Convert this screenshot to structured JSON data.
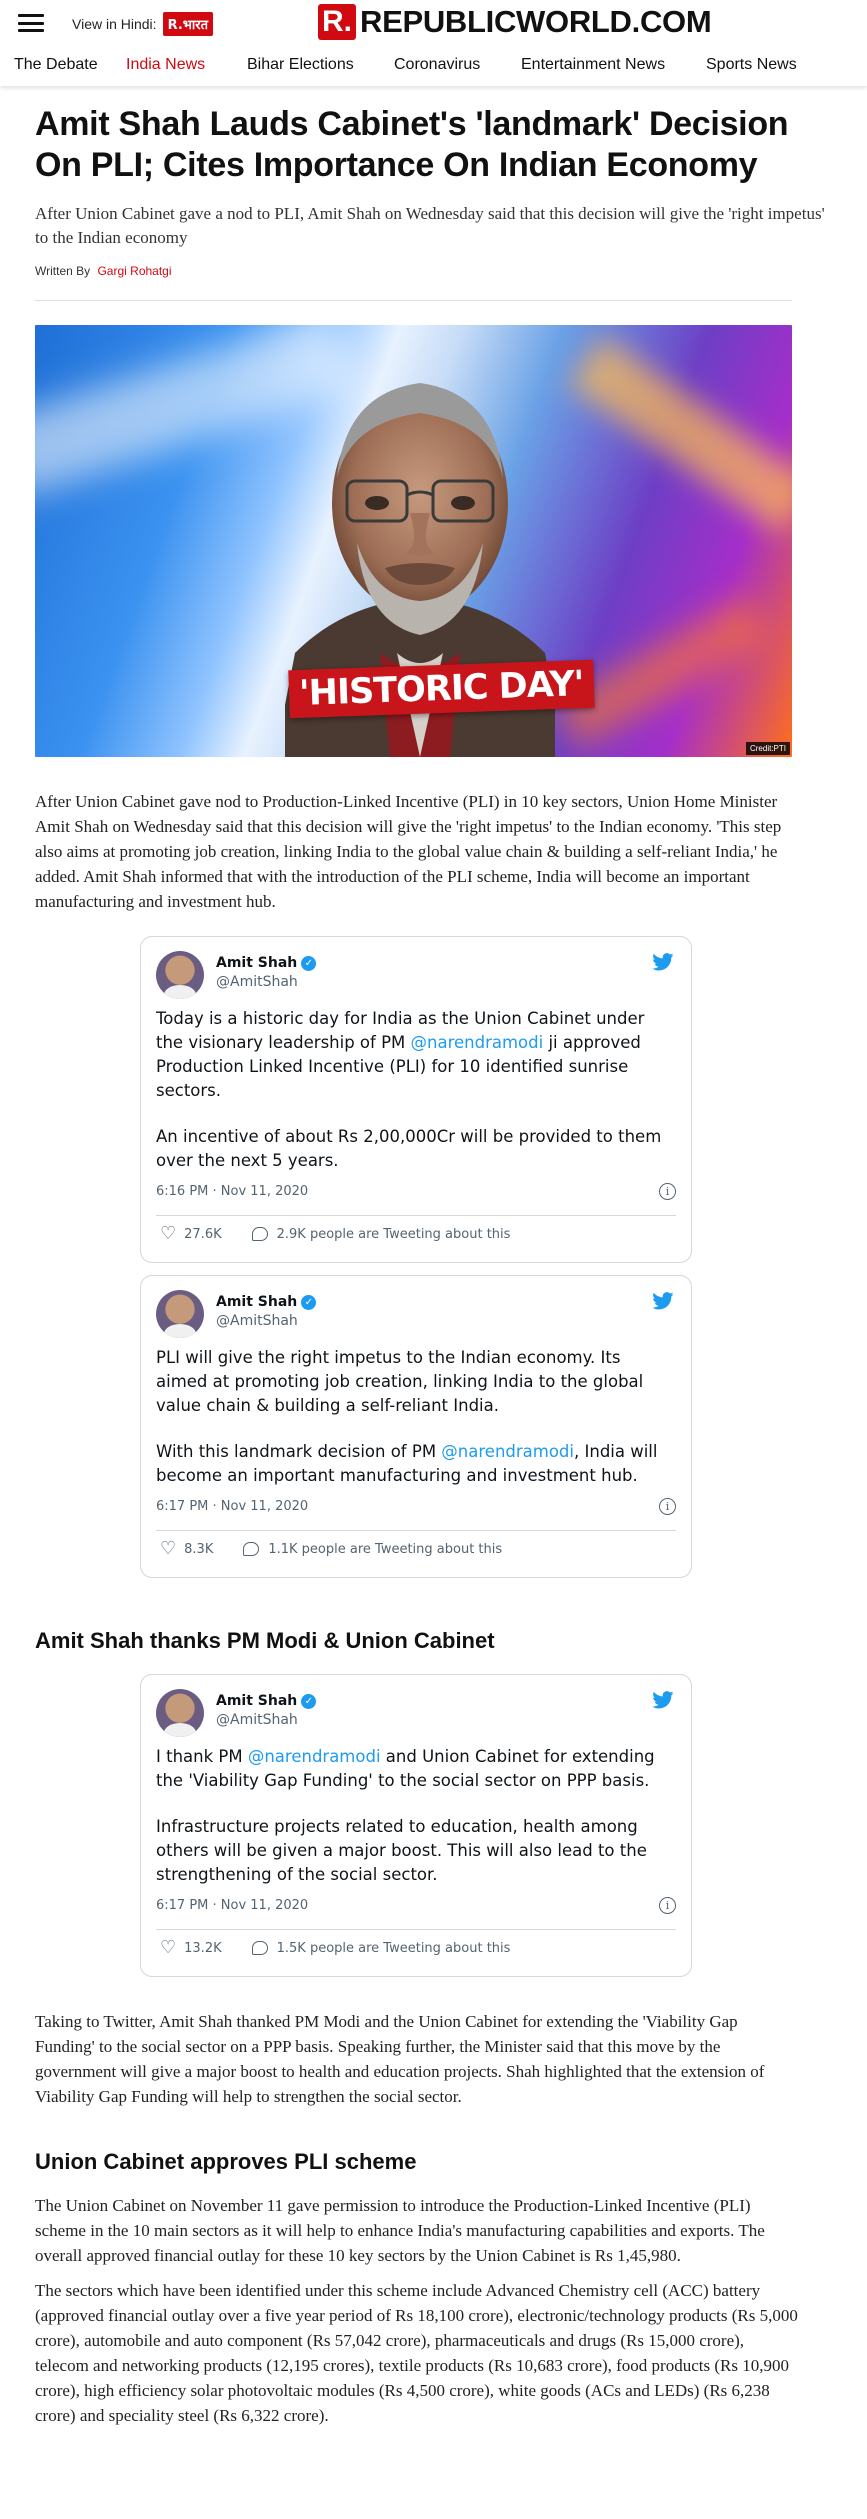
{
  "header": {
    "hindi_label": "View in Hindi:",
    "hindi_logo": "R.भारत",
    "brand_mark": "R.",
    "brand_name": "REPUBLICWORLD.COM",
    "nav": [
      "The Debate",
      "India News",
      "Bihar Elections",
      "Coronavirus",
      "Entertainment News",
      "Sports News"
    ],
    "active_nav": "India News",
    "accent_color": "#d10a11"
  },
  "article": {
    "title": "Amit Shah Lauds Cabinet's 'landmark' Decision On PLI; Cites Importance On Indian Economy",
    "dek": "After Union Cabinet gave a nod to PLI, Amit Shah on Wednesday said that this decision will give the 'right impetus' to the Indian economy",
    "byline_prefix": "Written By",
    "author": "Gargi Rohatgi",
    "image_caption": "'HISTORIC DAY'",
    "image_credit": "Credit:PTI",
    "paragraph_1": "After Union Cabinet gave nod to Production-Linked Incentive (PLI) in 10 key sectors, Union Home Minister Amit Shah on Wednesday said that this decision will give the 'right impetus' to the Indian economy. 'This step also aims at promoting job creation, linking India to the global value chain & building a self-reliant India,' he added. Amit Shah informed that with the introduction of the PLI scheme, India will become an important manufacturing and investment hub.",
    "heading_1": "Amit Shah thanks PM Modi & Union Cabinet",
    "paragraph_2": "Taking to Twitter, Amit Shah thanked PM Modi and the Union Cabinet for extending the 'Viability Gap Funding' to the social sector on a PPP basis. Speaking further, the Minister said that this move by the government will give a major boost to health and education projects. Shah highlighted that the extension of Viability Gap Funding will help to strengthen the social sector.",
    "heading_2": "Union Cabinet approves PLI scheme",
    "paragraph_3": "The Union Cabinet on November 11 gave permission to introduce the Production-Linked Incentive (PLI) scheme in the 10 main sectors as it will help to enhance India's manufacturing capabilities and exports. The overall approved financial outlay for these 10 key sectors by the Union Cabinet is Rs 1,45,980.",
    "paragraph_4": "The sectors which have been identified under this scheme include Advanced Chemistry cell (ACC) battery (approved financial outlay over a five year period of Rs 18,100 crore), electronic/technology products (Rs 5,000 crore), automobile and auto component (Rs 57,042 crore), pharmaceuticals and drugs (Rs 15,000 crore), telecom and networking products (12,195 crores), textile products (Rs 10,683 crore), food products (Rs 10,900 crore), high efficiency solar photovoltaic modules (Rs 4,500 crore), white goods (ACs and LEDs) (Rs 6,238 crore) and speciality steel (Rs 6,322 crore)."
  },
  "tweets": [
    {
      "name": "Amit Shah",
      "handle": "@AmitShah",
      "p1_before": "Today is a historic day for India as the Union Cabinet under the visionary leadership of PM ",
      "p1_mention": "@narendramodi",
      "p1_after": " ji approved Production Linked Incentive (PLI) for 10 identified sunrise sectors.",
      "p2": "An incentive of about Rs 2,00,000Cr will be provided to them over the next 5 years.",
      "p2_before": "",
      "p2_mention": "",
      "p2_after": "",
      "time": "6:16 PM · Nov 11, 2020",
      "likes": "27.6K",
      "replies": "2.9K people are Tweeting about this"
    },
    {
      "name": "Amit Shah",
      "handle": "@AmitShah",
      "p1_before": "PLI will give the right impetus to the Indian economy. Its aimed at promoting job creation, linking India to the global value chain & building a self-reliant India.",
      "p1_mention": "",
      "p1_after": "",
      "p2": "",
      "p2_before": "With this landmark decision of PM ",
      "p2_mention": "@narendramodi",
      "p2_after": ", India will become an important manufacturing and investment hub.",
      "time": "6:17 PM · Nov 11, 2020",
      "likes": "8.3K",
      "replies": "1.1K people are Tweeting about this"
    },
    {
      "name": "Amit Shah",
      "handle": "@AmitShah",
      "p1_before": "I thank PM ",
      "p1_mention": "@narendramodi",
      "p1_after": " and Union Cabinet for extending the 'Viability Gap Funding' to the social sector on PPP basis.",
      "p2": "Infrastructure projects related to education, health among others will be given a major boost. This will also lead to the strengthening of the social sector.",
      "p2_before": "",
      "p2_mention": "",
      "p2_after": "",
      "time": "6:17 PM · Nov 11, 2020",
      "likes": "13.2K",
      "replies": "1.5K people are Tweeting about this"
    }
  ],
  "icons": {
    "menu": "hamburger-icon",
    "twitter": "twitter-bird-icon",
    "verified": "verified-badge-icon",
    "info": "info-icon",
    "like": "heart-icon",
    "reply": "reply-icon"
  },
  "colors": {
    "brand_red": "#d10a11",
    "twitter_blue": "#1d9bf0",
    "muted_text": "#536471"
  }
}
